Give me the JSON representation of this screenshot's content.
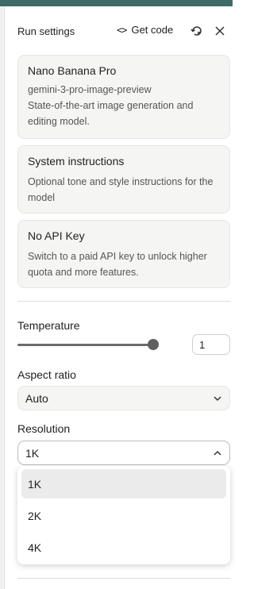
{
  "header": {
    "title": "Run settings",
    "get_code_label": "Get code",
    "code_icon_glyph": "<>",
    "icons": [
      "code-icon",
      "reset-icon",
      "close-icon"
    ]
  },
  "cards": [
    {
      "title": "Nano Banana Pro",
      "subtitle": "gemini-3-pro-image-preview",
      "description": "State-of-the-art image generation and editing model."
    },
    {
      "title": "System instructions",
      "description": "Optional tone and style instructions for the model"
    },
    {
      "title": "No API Key",
      "description": "Switch to a paid API key to unlock higher quota and more features."
    }
  ],
  "temperature": {
    "label": "Temperature",
    "value": "1",
    "slider_fraction": 1.0
  },
  "aspect_ratio": {
    "label": "Aspect ratio",
    "value": "Auto"
  },
  "resolution": {
    "label": "Resolution",
    "value": "1K",
    "options": [
      "1K",
      "2K",
      "4K"
    ],
    "selected_index": 0
  },
  "colors": {
    "top_bar": "#3f6b67",
    "card_bg": "#f5f5f3",
    "selected_option_bg": "#ebebeb"
  }
}
